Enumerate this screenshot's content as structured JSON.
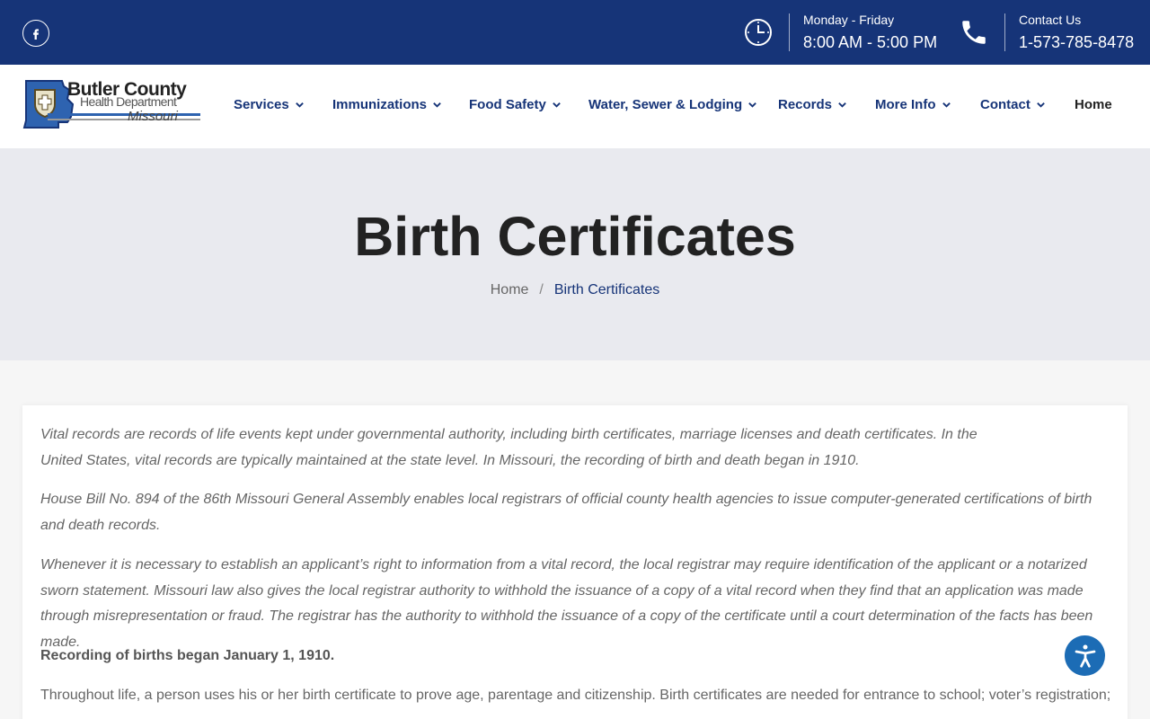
{
  "topbar": {
    "hours_label": "Monday - Friday",
    "hours_value": "8:00 AM - 5:00 PM",
    "contact_label": "Contact Us",
    "contact_value": "1-573-785-8478"
  },
  "logo": {
    "line1": "Butler County",
    "line2": "Health Department",
    "line3": "Missouri"
  },
  "nav": {
    "services": "Services",
    "immunizations": "Immunizations",
    "food_safety": "Food Safety",
    "water": "Water, Sewer & Lodging",
    "records": "Records",
    "more_info": "More Info",
    "contact": "Contact",
    "home": "Home"
  },
  "hero": {
    "title": "Birth Certificates",
    "breadcrumb_home": "Home",
    "breadcrumb_sep": "/",
    "breadcrumb_current": "Birth Certificates"
  },
  "content": {
    "p1": "Vital records are records of life events kept under governmental authority, including birth certificates, marriage licenses and death certificates. In the United States, vital records are typically maintained at the state level. In Missouri, the recording of birth and death began in 1910.",
    "p2": "House Bill No. 894 of the 86th Missouri General Assembly enables local registrars of official county health agencies to issue computer-generated certifications of birth and death records.",
    "p3": "Whenever it is necessary to establish an applicant’s right to information from a vital record, the local registrar may require identification of the applicant or a notarized sworn statement. Missouri law also gives the local registrar authority to withhold the issuance of a copy of a vital record when they find that an application was made through misrepresentation or fraud. The registrar has the authority to withhold the issuance of a copy of the certificate until a court determination of the facts has been made.",
    "p4": "Recording of births began January 1, 1910.",
    "p5": "Throughout life, a person uses his or her birth certificate to prove age, parentage and citizenship. Birth certificates are needed for entrance to school; voter’s registration;"
  },
  "icons": {
    "facebook": "facebook-icon",
    "clock": "clock-icon",
    "phone": "phone-icon",
    "accessibility": "accessibility-icon"
  },
  "colors": {
    "primary_navy": "#163478",
    "accessibility_blue": "#1c6cb5",
    "hero_bg": "#e9eaef"
  }
}
